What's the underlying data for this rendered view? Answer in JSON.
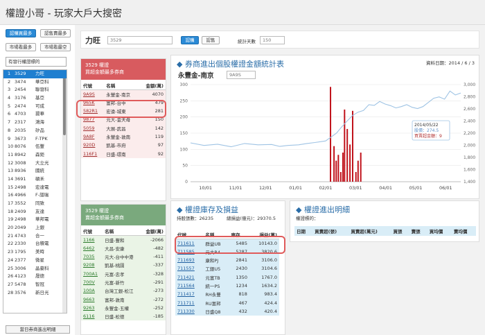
{
  "app": {
    "title": "權證小哥 - 玩家大戶大搜密"
  },
  "side": {
    "tabs": [
      "認購買最多",
      "認售賣最多",
      "市場看最多",
      "市場看最空"
    ],
    "select": "有發行權證標的",
    "bottom_button": "當日券商進出明細",
    "stocks": [
      [
        "1",
        "3529",
        "力旺"
      ],
      [
        "2",
        "3474",
        "華亞科"
      ],
      [
        "3",
        "2454",
        "聯發科"
      ],
      [
        "4",
        "3176",
        "基亞"
      ],
      [
        "5",
        "2474",
        "可成"
      ],
      [
        "6",
        "4703",
        "揚華"
      ],
      [
        "7",
        "2317",
        "鴻海"
      ],
      [
        "8",
        "2035",
        "矽品"
      ],
      [
        "9",
        "3673",
        "F-TPK"
      ],
      [
        "10",
        "8076",
        "伍豐"
      ],
      [
        "11",
        "8942",
        "森鉅"
      ],
      [
        "12",
        "3008",
        "大立光"
      ],
      [
        "13",
        "8936",
        "國統"
      ],
      [
        "14",
        "3691",
        "碩禾"
      ],
      [
        "15",
        "2498",
        "宏達電"
      ],
      [
        "16",
        "4966",
        "F-譜瑞"
      ],
      [
        "17",
        "3552",
        "同致"
      ],
      [
        "18",
        "2409",
        "友達"
      ],
      [
        "19",
        "2498",
        "華邦電"
      ],
      [
        "20",
        "2049",
        "上銀"
      ],
      [
        "21",
        "4743",
        "合一"
      ],
      [
        "22",
        "2330",
        "台積電"
      ],
      [
        "23",
        "1795",
        "美時"
      ],
      [
        "24",
        "2377",
        "微星"
      ],
      [
        "25",
        "3006",
        "晶豪科"
      ],
      [
        "26",
        "4123",
        "晟德"
      ],
      [
        "27",
        "5478",
        "智冠"
      ],
      [
        "28",
        "3576",
        "新日光"
      ]
    ]
  },
  "toolbar": {
    "name": "力旺",
    "code": "3529",
    "btn_buy": "認購",
    "btn_sell": "認售",
    "days_label": "統計天數",
    "days": "150"
  },
  "buybox": {
    "title1": "3529 權證",
    "title2": "買超金額最多券商",
    "cols": [
      "代號",
      "名稱",
      "金額(萬)"
    ],
    "rows": [
      [
        "9A9S",
        "永豐金-南京",
        "4070"
      ],
      [
        "965K",
        "富邦-台中",
        "479"
      ],
      [
        "582R1",
        "宏遠-城東",
        "281"
      ],
      [
        "9877",
        "元大-金天母",
        "150"
      ],
      [
        "5059",
        "大展-武昌",
        "142"
      ],
      [
        "9A8F",
        "永豐金-敦南",
        "119"
      ],
      [
        "920D",
        "凱基-市府",
        "97"
      ],
      [
        "116F1",
        "日盛-環南",
        "92"
      ]
    ],
    "hidden_row": [
      "",
      "",
      ""
    ]
  },
  "sellbox": {
    "title1": "3529 權證",
    "title2": "賣超金額最多券商",
    "cols": [
      "代號",
      "名稱",
      "金額(萬)"
    ],
    "rows": [
      [
        "1166",
        "日盛-豐和",
        "-2066"
      ],
      [
        "6462",
        "大昌-安康",
        "-482"
      ],
      [
        "7035",
        "元大-台中中港",
        "-411"
      ],
      [
        "9208",
        "凱基-桃園",
        "-337"
      ],
      [
        "700A1",
        "元富-忠孝",
        "-328"
      ],
      [
        "700V",
        "元富-新竹",
        "-291"
      ],
      [
        "100A",
        "台灣工銀-松江",
        "-273"
      ],
      [
        "9663",
        "富邦-敦南",
        "-272"
      ],
      [
        "9263",
        "永豐金-五權",
        "-252"
      ],
      [
        "6116",
        "日盛-松德",
        "-185"
      ]
    ]
  },
  "chart": {
    "title": "券商進出個股權證金額統計表",
    "date_label": "資料日期：2014 / 6 / 3",
    "broker": "永豐金-南京",
    "broker_code": "9A9S",
    "tooltip": {
      "date": "2014/05/22",
      "price_label": "股價：274.5",
      "amt_label": "買賣超金額：9"
    },
    "chart_data": {
      "type": "bar+line",
      "x": [
        "10/01",
        "11/01",
        "12/01",
        "01/01",
        "02/01",
        "03/01",
        "04/01",
        "05/01",
        "06/01"
      ],
      "yleft": [
        0,
        50,
        100,
        150,
        200,
        250,
        300
      ],
      "yright": [
        1400,
        1600,
        1800,
        2000,
        2200,
        2400,
        2600,
        2800,
        3000
      ],
      "bars": [
        [
          0.518,
          2930
        ],
        [
          0.531,
          1100
        ],
        [
          0.539,
          650
        ],
        [
          0.547,
          830
        ],
        [
          0.556,
          300
        ],
        [
          0.564,
          900
        ],
        [
          0.57,
          2230
        ],
        [
          0.58,
          1630
        ],
        [
          0.59,
          1150
        ],
        [
          0.6,
          2190
        ],
        [
          0.612,
          300
        ],
        [
          0.62,
          650
        ],
        [
          0.63,
          900
        ]
      ],
      "line": [
        [
          0.0,
          120
        ],
        [
          0.05,
          112
        ],
        [
          0.1,
          116
        ],
        [
          0.15,
          108
        ],
        [
          0.2,
          118
        ],
        [
          0.25,
          114
        ],
        [
          0.3,
          115
        ],
        [
          0.33,
          109
        ],
        [
          0.36,
          112
        ],
        [
          0.4,
          114
        ],
        [
          0.43,
          118
        ],
        [
          0.46,
          121
        ],
        [
          0.5,
          126
        ],
        [
          0.52,
          138
        ],
        [
          0.54,
          150
        ],
        [
          0.56,
          170
        ],
        [
          0.58,
          188
        ],
        [
          0.6,
          205
        ],
        [
          0.62,
          215
        ],
        [
          0.64,
          220
        ],
        [
          0.66,
          238
        ],
        [
          0.68,
          236
        ],
        [
          0.7,
          248
        ],
        [
          0.72,
          240
        ],
        [
          0.74,
          235
        ],
        [
          0.76,
          228
        ],
        [
          0.78,
          232
        ],
        [
          0.8,
          238
        ],
        [
          0.82,
          230
        ],
        [
          0.84,
          226
        ],
        [
          0.86,
          232
        ],
        [
          0.88,
          245
        ],
        [
          0.9,
          258
        ],
        [
          0.92,
          262
        ],
        [
          0.94,
          255
        ],
        [
          0.96,
          280
        ],
        [
          0.98,
          268
        ],
        [
          1.0,
          274
        ]
      ]
    }
  },
  "stock": {
    "title": "權證庫存及損益",
    "holding": "持股張數：26235",
    "pnl": "總損益(億元)：29370.5",
    "cols": [
      "代號",
      "名稱",
      "庫存",
      "損益(萬)"
    ],
    "rows": [
      [
        "711611",
        "群益UB",
        "5485",
        "10143.0"
      ],
      [
        "711585",
        "元大R4",
        "5287",
        "3820.6"
      ],
      [
        "711693",
        "康和PJ",
        "2841",
        "3106.0"
      ],
      [
        "711557",
        "工銀U5",
        "2430",
        "3104.6"
      ],
      [
        "711421",
        "元富TB",
        "1350",
        "1767.0"
      ],
      [
        "711564",
        "統一PS",
        "1234",
        "1634.2"
      ],
      [
        "711417",
        "RH永豐",
        "818",
        "983.4"
      ],
      [
        "711711",
        "RU富邦",
        "467",
        "424.4"
      ],
      [
        "711330",
        "日盛Q8",
        "432",
        "420.4"
      ]
    ]
  },
  "detail": {
    "title": "權證進出明細",
    "label": "權證標的：",
    "cols": [
      "日期",
      "買賣超(張)",
      "買賣超(萬元)",
      "買張",
      "賣張",
      "買均價",
      "賣均價"
    ]
  }
}
